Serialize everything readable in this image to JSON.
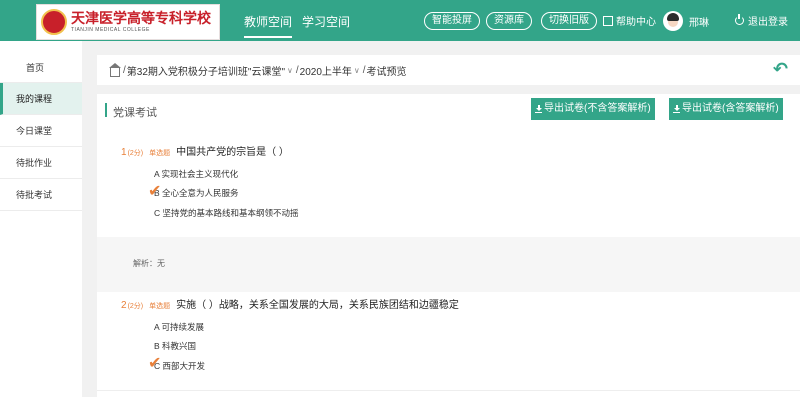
{
  "header": {
    "logo_cn": "天津医学高等专科学校",
    "logo_en": "TIANJIN MEDICAL COLLEGE",
    "nav": [
      "教师空间",
      "学习空间"
    ],
    "pills": [
      "智能投屏",
      "资源库",
      "切换旧版"
    ],
    "help": "帮助中心",
    "username": "邢琳",
    "logout": "退出登录",
    "accent_color": "#33a589"
  },
  "sidebar": {
    "items": [
      "首页",
      "我的课程",
      "今日课堂",
      "待批作业",
      "待批考试"
    ]
  },
  "breadcrumb": {
    "sep": "/",
    "course": "第32期入党积极分子培训班\"云课堂\"",
    "term": "2020上半年",
    "page": "考试预览",
    "arrow": "∨"
  },
  "main": {
    "title": "党课考试",
    "export_no_answer": "导出试卷(不含答案解析)",
    "export_with_answer": "导出试卷(含答案解析)"
  },
  "questions": [
    {
      "num": "1",
      "score": "(2分)",
      "type": "单选题",
      "text": "中国共产党的宗旨是（ ）",
      "options": [
        "A 实现社会主义现代化",
        "B 全心全意为人民服务",
        "C 坚持党的基本路线和基本纲领不动摇"
      ],
      "analysis": "解析：无"
    },
    {
      "num": "2",
      "score": "(2分)",
      "type": "单选题",
      "text": "实施（ ）战略，关系全国发展的大局，关系民族团结和边疆稳定",
      "options": [
        "A 可持续发展",
        "B 科教兴国",
        "C 西部大开发"
      ]
    }
  ]
}
